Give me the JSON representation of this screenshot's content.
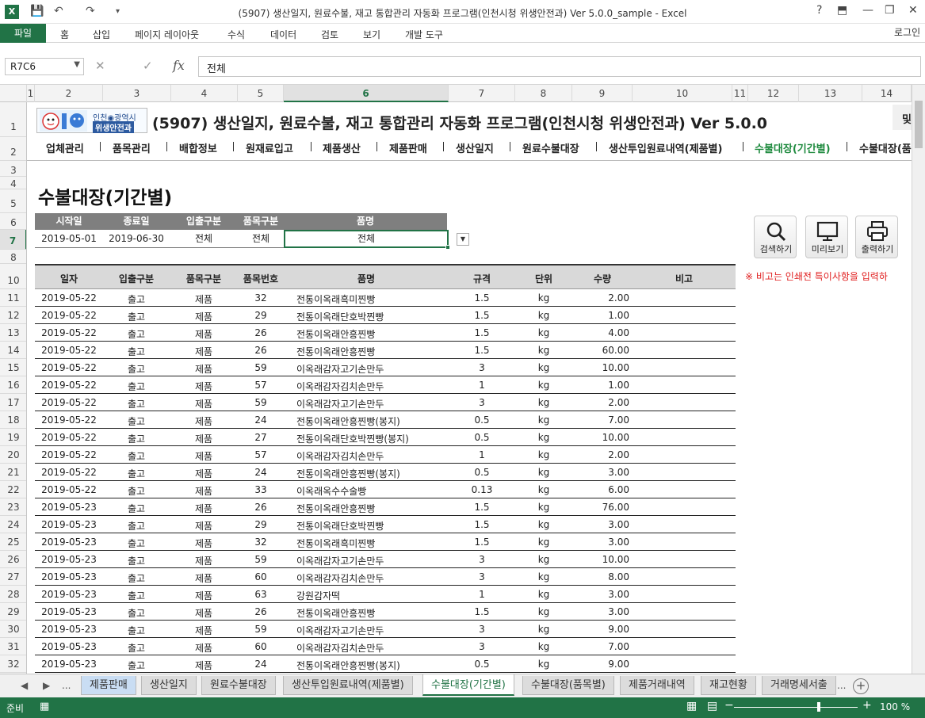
{
  "window": {
    "title": "(5907) 생산일지, 원료수불, 재고 통합관리 자동화 프로그램(인천시청 위생안전과) Ver 5.0.0_sample - Excel",
    "app_icon": "X",
    "help": "?",
    "minimize": "—",
    "restore": "❐",
    "close": "✕"
  },
  "ribbon": {
    "file": "파일",
    "tabs": [
      "홈",
      "삽입",
      "페이지 레이아웃",
      "수식",
      "데이터",
      "검토",
      "보기",
      "개발 도구"
    ],
    "login": "로그인"
  },
  "formula_bar": {
    "cell_ref": "R7C6",
    "value": "전체",
    "fx": "fx"
  },
  "columns": [
    "1",
    "2",
    "3",
    "4",
    "5",
    "6",
    "7",
    "8",
    "9",
    "10",
    "11",
    "12",
    "13",
    "14"
  ],
  "rows": [
    "1",
    "2",
    "3",
    "4",
    "5",
    "6",
    "7",
    "8",
    "10",
    "11",
    "12",
    "13",
    "14",
    "15",
    "16",
    "17",
    "18",
    "19",
    "20",
    "21",
    "22",
    "23",
    "24",
    "25",
    "26",
    "27",
    "28",
    "29",
    "30",
    "31",
    "32"
  ],
  "banner": {
    "logo_line1": "인천◉광역시",
    "logo_line2": "위생안전과",
    "title": "(5907) 생산일지, 원료수불, 재고 통합관리 자동화 프로그램(인천시청 위생안전과) Ver 5.0.0",
    "cut_text": "및"
  },
  "menu": {
    "items": [
      "업체관리",
      "품목관리",
      "배합정보",
      "원재료입고",
      "제품생산",
      "제품판매",
      "생산일지",
      "원료수불대장",
      "생산투입원료내역(제품별)",
      "수불대장(기간별)",
      "수불대장(품"
    ],
    "active_index": 9
  },
  "page_heading": "수불대장(기간별)",
  "filter": {
    "headers": [
      "시작일",
      "종료일",
      "입출구분",
      "품목구분",
      "품명"
    ],
    "values": [
      "2019-05-01",
      "2019-06-30",
      "전체",
      "전체",
      "전체"
    ]
  },
  "buttons": {
    "search": "검색하기",
    "preview": "미리보기",
    "print": "출력하기"
  },
  "note": "※ 비고는 인쇄전 특이사항을 입력하",
  "table": {
    "headers": [
      "일자",
      "입출구분",
      "품목구분",
      "품목번호",
      "품명",
      "규격",
      "단위",
      "수량",
      "비고"
    ],
    "rows": [
      [
        "2019-05-22",
        "출고",
        "제품",
        "32",
        "전통이옥래흑미찐빵",
        "1.5",
        "kg",
        "2.00",
        ""
      ],
      [
        "2019-05-22",
        "출고",
        "제품",
        "29",
        "전통이옥래단호박찐빵",
        "1.5",
        "kg",
        "1.00",
        ""
      ],
      [
        "2019-05-22",
        "출고",
        "제품",
        "26",
        "전통이옥래안흥찐빵",
        "1.5",
        "kg",
        "4.00",
        ""
      ],
      [
        "2019-05-22",
        "출고",
        "제품",
        "26",
        "전통이옥래안흥찐빵",
        "1.5",
        "kg",
        "60.00",
        ""
      ],
      [
        "2019-05-22",
        "출고",
        "제품",
        "59",
        "이옥래감자고기손만두",
        "3",
        "kg",
        "10.00",
        ""
      ],
      [
        "2019-05-22",
        "출고",
        "제품",
        "57",
        "이옥래감자김치손만두",
        "1",
        "kg",
        "1.00",
        ""
      ],
      [
        "2019-05-22",
        "출고",
        "제품",
        "59",
        "이옥래감자고기손만두",
        "3",
        "kg",
        "2.00",
        ""
      ],
      [
        "2019-05-22",
        "출고",
        "제품",
        "24",
        "전통이옥래안흥찐빵(봉지)",
        "0.5",
        "kg",
        "7.00",
        ""
      ],
      [
        "2019-05-22",
        "출고",
        "제품",
        "27",
        "전통이옥래단호박찐빵(봉지)",
        "0.5",
        "kg",
        "10.00",
        ""
      ],
      [
        "2019-05-22",
        "출고",
        "제품",
        "57",
        "이옥래감자김치손만두",
        "1",
        "kg",
        "2.00",
        ""
      ],
      [
        "2019-05-22",
        "출고",
        "제품",
        "24",
        "전통이옥래안흥찐빵(봉지)",
        "0.5",
        "kg",
        "3.00",
        ""
      ],
      [
        "2019-05-22",
        "출고",
        "제품",
        "33",
        "이옥래옥수수술빵",
        "0.13",
        "kg",
        "6.00",
        ""
      ],
      [
        "2019-05-23",
        "출고",
        "제품",
        "26",
        "전통이옥래안흥찐빵",
        "1.5",
        "kg",
        "76.00",
        ""
      ],
      [
        "2019-05-23",
        "출고",
        "제품",
        "29",
        "전통이옥래단호박찐빵",
        "1.5",
        "kg",
        "3.00",
        ""
      ],
      [
        "2019-05-23",
        "출고",
        "제품",
        "32",
        "전통이옥래흑미찐빵",
        "1.5",
        "kg",
        "3.00",
        ""
      ],
      [
        "2019-05-23",
        "출고",
        "제품",
        "59",
        "이옥래감자고기손만두",
        "3",
        "kg",
        "10.00",
        ""
      ],
      [
        "2019-05-23",
        "출고",
        "제품",
        "60",
        "이옥래감자김치손만두",
        "3",
        "kg",
        "8.00",
        ""
      ],
      [
        "2019-05-23",
        "출고",
        "제품",
        "63",
        "강원감자떡",
        "1",
        "kg",
        "3.00",
        ""
      ],
      [
        "2019-05-23",
        "출고",
        "제품",
        "26",
        "전통이옥래안흥찐빵",
        "1.5",
        "kg",
        "3.00",
        ""
      ],
      [
        "2019-05-23",
        "출고",
        "제품",
        "59",
        "이옥래감자고기손만두",
        "3",
        "kg",
        "9.00",
        ""
      ],
      [
        "2019-05-23",
        "출고",
        "제품",
        "60",
        "이옥래감자김치손만두",
        "3",
        "kg",
        "7.00",
        ""
      ],
      [
        "2019-05-23",
        "출고",
        "제품",
        "24",
        "전통이옥래안흥찐빵(봉지)",
        "0.5",
        "kg",
        "9.00",
        ""
      ]
    ]
  },
  "sheet_tabs": {
    "nav": [
      "◀",
      "▶",
      "..."
    ],
    "tabs": [
      "제품판매",
      "생산일지",
      "원료수불대장",
      "생산투입원료내역(제품별)",
      "수불대장(기간별)",
      "수불대장(품목별)",
      "제품거래내역",
      "재고현황",
      "거래명세서출"
    ],
    "active_index": 4,
    "more": "...",
    "add": "+"
  },
  "status": {
    "ready": "준비",
    "zoom": "100 %",
    "zoom_minus": "−",
    "zoom_plus": "+"
  },
  "colors": {
    "excel_green": "#217346",
    "active_menu": "#1e8a3e",
    "note_red": "#e01e1e",
    "header_gray": "#7f7f7f"
  }
}
